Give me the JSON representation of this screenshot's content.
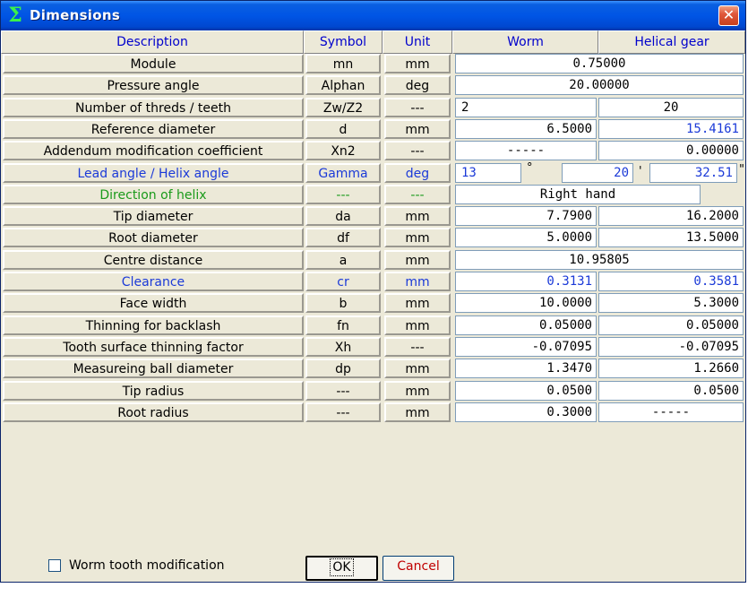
{
  "window": {
    "title": "Dimensions",
    "icon": "sigma-icon",
    "title_icon_glyph": "Σ",
    "close_glyph": "✕"
  },
  "headers": [
    "Description",
    "Symbol",
    "Unit",
    "Worm",
    "Helical gear"
  ],
  "rows": [
    {
      "description": "Module",
      "symbol": "mn",
      "unit": "mm",
      "worm": "0.75000",
      "gear": ""
    },
    {
      "description": "Pressure angle",
      "symbol": "Alphan",
      "unit": "deg",
      "worm": "20.00000",
      "gear": ""
    },
    {
      "description": "Number of threds / teeth",
      "symbol": "Zw/Z2",
      "unit": "---",
      "worm": "2",
      "gear": "20"
    },
    {
      "description": "Reference diameter",
      "symbol": "d",
      "unit": "mm",
      "worm": "6.5000",
      "gear": "15.4161"
    },
    {
      "description": "Addendum modification coefficient",
      "symbol": "Xn2",
      "unit": "---",
      "worm": "-----",
      "gear": "0.00000"
    },
    {
      "description": "Lead angle / Helix angle",
      "symbol": "Gamma",
      "unit": "deg",
      "deg": "13",
      "min": "20",
      "sec": "32.51",
      "deg_mark": "°",
      "min_mark": "'",
      "sec_mark": "\""
    },
    {
      "description": "Direction of helix",
      "symbol": "---",
      "unit": "---",
      "worm": "Right hand",
      "gear": ""
    },
    {
      "description": "Tip diameter",
      "symbol": "da",
      "unit": "mm",
      "worm": "7.7900",
      "gear": "16.2000"
    },
    {
      "description": "Root diameter",
      "symbol": "df",
      "unit": "mm",
      "worm": "5.0000",
      "gear": "13.5000"
    },
    {
      "description": "Centre distance",
      "symbol": "a",
      "unit": "mm",
      "worm": "10.95805",
      "gear": ""
    },
    {
      "description": "Clearance",
      "symbol": "cr",
      "unit": "mm",
      "worm": "0.3131",
      "gear": "0.3581"
    },
    {
      "description": "Face width",
      "symbol": "b",
      "unit": "mm",
      "worm": "10.0000",
      "gear": "5.3000"
    },
    {
      "description": "Thinning for backlash",
      "symbol": "fn",
      "unit": "mm",
      "worm": "0.05000",
      "gear": "0.05000"
    },
    {
      "description": "Tooth surface thinning factor",
      "symbol": "Xh",
      "unit": "---",
      "worm": "-0.07095",
      "gear": "-0.07095"
    },
    {
      "description": "Measureing ball diameter",
      "symbol": "dp",
      "unit": "mm",
      "worm": "1.3470",
      "gear": "1.2660"
    },
    {
      "description": "Tip radius",
      "symbol": "---",
      "unit": "mm",
      "worm": "0.0500",
      "gear": "0.0500"
    },
    {
      "description": "Root radius",
      "symbol": "---",
      "unit": "mm",
      "worm": "0.3000",
      "gear": "-----"
    }
  ],
  "footer": {
    "checkbox_label": "Worm tooth modification",
    "checkbox_checked": false,
    "ok_label": "OK",
    "cancel_label": "Cancel"
  },
  "colors": {
    "label_blue": "#1b3ad8",
    "label_green": "#1a9a1a",
    "cancel_red": "#c00000"
  }
}
